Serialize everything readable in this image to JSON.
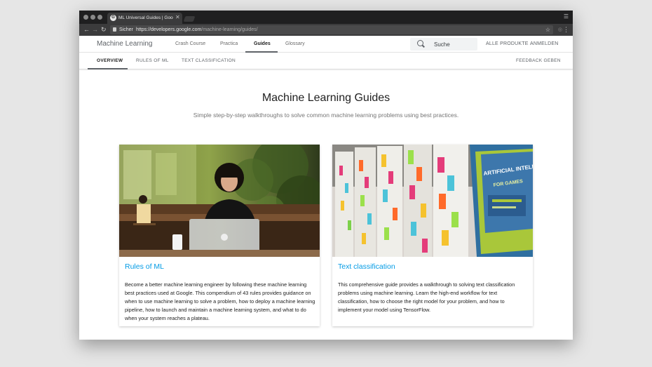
{
  "browser": {
    "tab_title": "ML Universal Guides | Google",
    "tab_close": "✕",
    "secure_label": "Sicher",
    "url_host": "https://developers.google.com",
    "url_path": "/machine-learning/guides/",
    "star": "☆",
    "menu": "⋮",
    "profile": "☰"
  },
  "header": {
    "site_title": "Machine Learning",
    "nav": [
      {
        "label": "Crash Course"
      },
      {
        "label": "Practica"
      },
      {
        "label": "Guides"
      },
      {
        "label": "Glossary"
      }
    ],
    "search_placeholder": "Suche",
    "all_products": "ALLE PRODUKTE",
    "sign_in": "ANMELDEN"
  },
  "subnav": {
    "items": [
      {
        "label": "OVERVIEW"
      },
      {
        "label": "RULES OF ML"
      },
      {
        "label": "TEXT CLASSIFICATION"
      }
    ],
    "feedback": "FEEDBACK GEBEN"
  },
  "main": {
    "title": "Machine Learning Guides",
    "subtitle": "Simple step-by-step walkthroughs to solve common machine learning problems using best practices.",
    "cards": [
      {
        "title": "Rules of ML",
        "text": "Become a better machine learning engineer by following these machine learning best practices used at Google. This compendium of 43 rules provides guidance on when to use machine learning to solve a problem, how to deploy a machine learning pipeline, how to launch and maintain a machine learning system, and what to do when your system reaches a plateau."
      },
      {
        "title": "Text classification",
        "text": "This comprehensive guide provides a walkthrough to solving text classification problems using machine learning. Learn the high-end workflow for text classification, how to choose the right model for your problem, and how to implement your model using TensorFlow.",
        "book_title": "ARTIFICIAL INTELLIGENCE",
        "book_subtitle": "FOR GAMES"
      }
    ]
  },
  "colors": {
    "link": "#039be5",
    "chrome_dark": "#1f1f20",
    "chrome_bar": "#3b3b3c"
  }
}
